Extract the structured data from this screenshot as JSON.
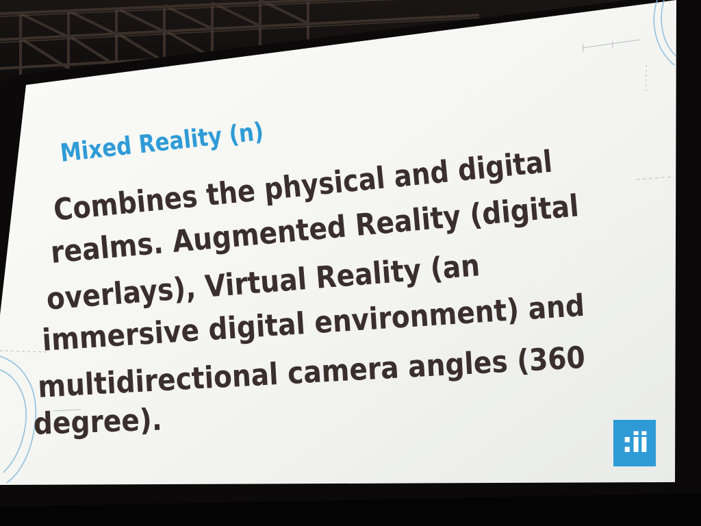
{
  "slide": {
    "title": "Mixed Reality (n)",
    "body_lines": [
      "Combines the physical and digital",
      "realms. Augmented Reality (digital",
      "overlays), Virtual Reality (an",
      "immersive digital environment) and",
      "multidirectional camera angles (360",
      "degree)."
    ],
    "logo": ":ii"
  },
  "colors": {
    "title": "#2f9bd6",
    "body": "#3a2f2c",
    "slide_background": "#f4f4f1",
    "logo_background": "#2f9bd6",
    "stage": "#0a0808"
  }
}
